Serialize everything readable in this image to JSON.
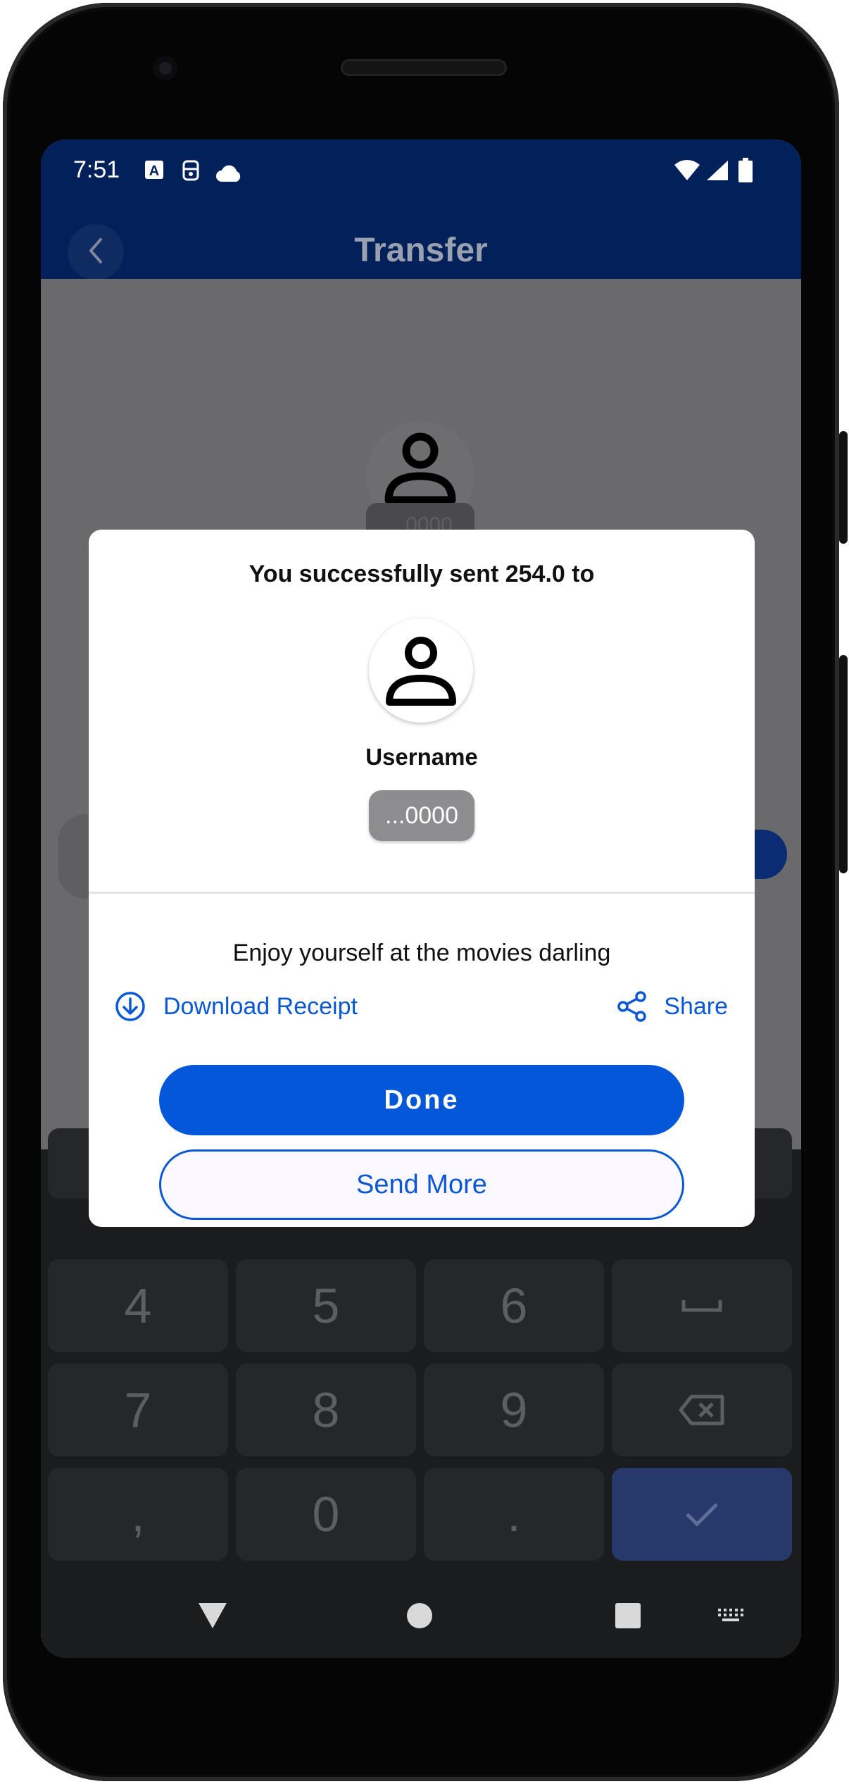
{
  "status_bar": {
    "time": "7:51",
    "left_icons": [
      "translate-icon",
      "vpn-icon",
      "cloud-icon"
    ],
    "right_icons": [
      "wifi-icon",
      "signal-icon",
      "battery-icon"
    ]
  },
  "app_bar": {
    "title": "Transfer",
    "back_icon": "chevron-left-icon"
  },
  "background": {
    "chip_text": "...0000"
  },
  "dialog": {
    "title": "You successfully sent 254.0 to",
    "username": "Username",
    "account_chip": "...0000",
    "message": "Enjoy yourself at the movies darling",
    "download_label": "Download Receipt",
    "share_label": "Share",
    "done_label": "Done",
    "send_more_label": "Send More"
  },
  "keyboard": {
    "rows": [
      [
        "4",
        "5",
        "6",
        "space"
      ],
      [
        "7",
        "8",
        "9",
        "backspace"
      ],
      [
        ",",
        "0",
        ".",
        "done"
      ]
    ]
  },
  "colors": {
    "primary": "#0457d8",
    "app_bar": "#02205a",
    "scrim": "#6a696b"
  }
}
